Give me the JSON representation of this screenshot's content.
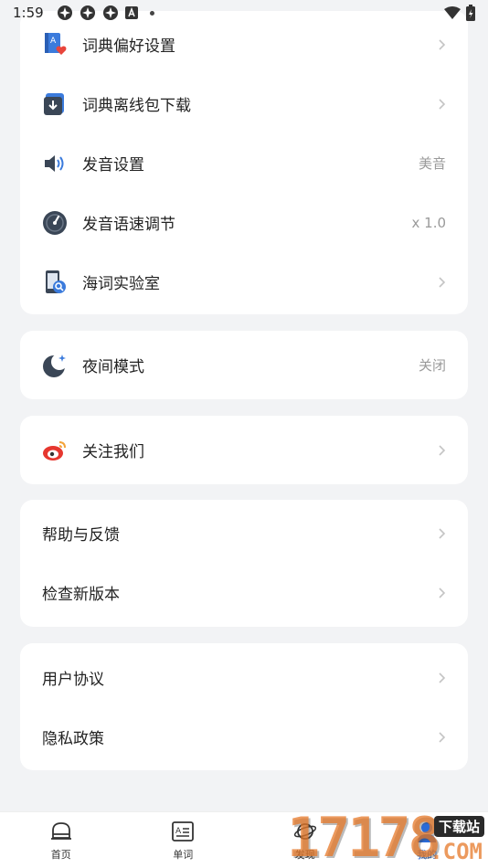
{
  "status": {
    "time": "1:59"
  },
  "settings_card": {
    "items": [
      {
        "label": "词典偏好设置",
        "value": ""
      },
      {
        "label": "词典离线包下载",
        "value": ""
      },
      {
        "label": "发音设置",
        "value": "美音"
      },
      {
        "label": "发音语速调节",
        "value": "x 1.0"
      },
      {
        "label": "海词实验室",
        "value": ""
      }
    ]
  },
  "night_card": {
    "label": "夜间模式",
    "value": "关闭"
  },
  "follow_card": {
    "label": "关注我们"
  },
  "help_card": {
    "items": [
      {
        "label": "帮助与反馈"
      },
      {
        "label": "检查新版本"
      }
    ]
  },
  "legal_card": {
    "items": [
      {
        "label": "用户协议"
      },
      {
        "label": "隐私政策"
      }
    ]
  },
  "tabbar": {
    "tabs": [
      {
        "label": "首页",
        "icon": "home-icon"
      },
      {
        "label": "单词",
        "icon": "word-card-icon"
      },
      {
        "label": "发现",
        "icon": "planet-icon"
      },
      {
        "label": "我的",
        "icon": "user-icon"
      }
    ]
  },
  "watermark": {
    "number": "17178",
    "tag": "下载站",
    "suffix": ".COM"
  },
  "colors": {
    "accent": "#2a6bd8",
    "icon_dark": "#3a4656",
    "icon_blue": "#3b7bdc",
    "heart_red": "#e8453c",
    "weibo_red": "#e6372f"
  }
}
